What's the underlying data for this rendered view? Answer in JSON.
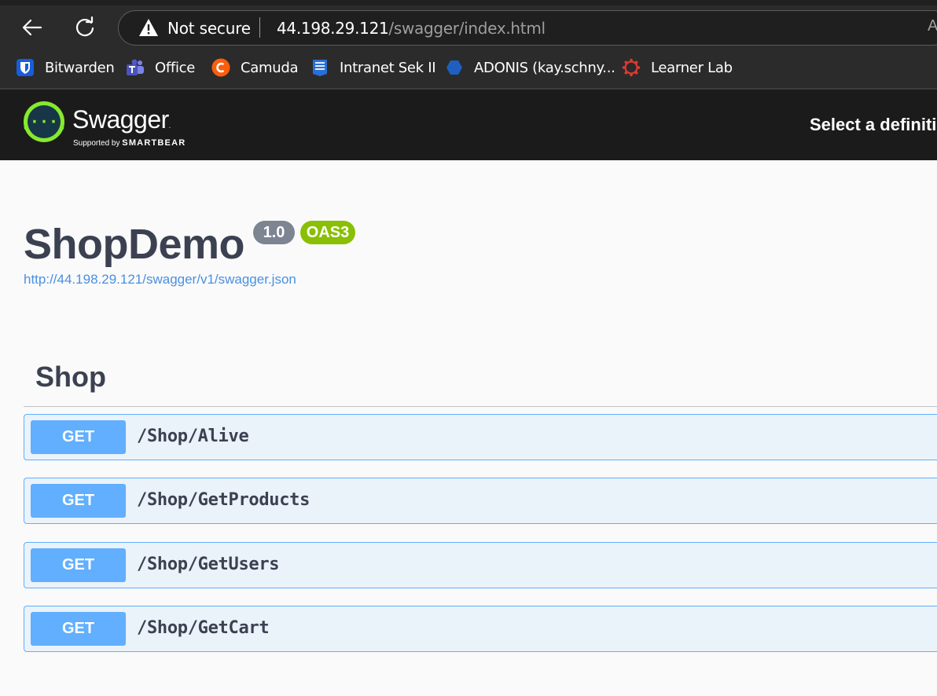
{
  "browser": {
    "security_label": "Not secure",
    "url_host": "44.198.29.121",
    "url_path": "/swagger/index.html",
    "reader_glyph": "A",
    "bookmarks": [
      {
        "label": "Bitwarden",
        "icon": "bitwarden-icon"
      },
      {
        "label": "Office",
        "icon": "teams-icon"
      },
      {
        "label": "Camuda",
        "icon": "camunda-icon"
      },
      {
        "label": "Intranet Sek II",
        "icon": "document-icon"
      },
      {
        "label": "ADONIS (kay.schny...",
        "icon": "hexagon-icon"
      },
      {
        "label": "Learner Lab",
        "icon": "canvas-icon"
      }
    ]
  },
  "topbar": {
    "logo_word": "Swagger",
    "logo_tm": ".",
    "supported_by": "Supported by",
    "smartbear": "SMARTBEAR",
    "select_definition": "Select a definition"
  },
  "info": {
    "title": "ShopDemo",
    "version": "1.0",
    "oas": "OAS3",
    "spec_url": "http://44.198.29.121/swagger/v1/swagger.json"
  },
  "tag": {
    "name": "Shop",
    "operations": [
      {
        "method": "GET",
        "path": "/Shop/Alive"
      },
      {
        "method": "GET",
        "path": "/Shop/GetProducts"
      },
      {
        "method": "GET",
        "path": "/Shop/GetUsers"
      },
      {
        "method": "GET",
        "path": "/Shop/GetCart"
      }
    ]
  },
  "colors": {
    "get_method": "#61affe",
    "oas_badge": "#89bf04",
    "version_badge": "#7d8492",
    "swagger_green": "#85ea2d"
  }
}
